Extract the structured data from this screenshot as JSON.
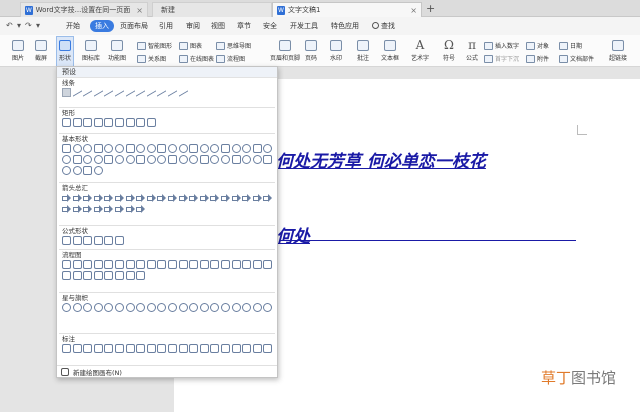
{
  "tabs": [
    {
      "label": "Word文字技...设置在同一页面",
      "active": false
    },
    {
      "label": "新建",
      "active": false
    },
    {
      "label": "文字文稿1",
      "active": true
    }
  ],
  "menu": {
    "items": [
      "开始",
      "插入",
      "页面布局",
      "引用",
      "审阅",
      "视图",
      "章节",
      "安全",
      "开发工具",
      "特色应用"
    ],
    "active": "插入",
    "search": "查找"
  },
  "ribbon": {
    "picture": "图片",
    "screenshot": "截屏",
    "shapes": "形状",
    "icon_lib": "图标库",
    "function_chart": "功能图",
    "smart_graphic": "智能图形",
    "relation_chart": "关系图",
    "chart": "图表",
    "online_chart": "在线图表",
    "mind_map": "思维导图",
    "flowchart": "流程图",
    "header_footer": "页眉和页脚",
    "page_number": "页码",
    "watermark": "水印",
    "comment": "批注",
    "textbox": "文本框",
    "art_text": "艺术字",
    "symbol": "符号",
    "formula": "公式",
    "insert_number": "插入数字",
    "object": "对象",
    "date": "日期",
    "first_letter": "首字下沉",
    "attachment": "附件",
    "doc_parts": "文档部件",
    "hyperlink": "超链接"
  },
  "document": {
    "line1": "谁何处无芳草 何必单恋一枝花",
    "line2": "谁何处"
  },
  "dropdown": {
    "header": "预设",
    "sections": [
      {
        "title": "线条",
        "count": 12
      },
      {
        "title": "矩形",
        "count": 9
      },
      {
        "title": "基本形状",
        "count": 44
      },
      {
        "title": "箭头总汇",
        "count": 28
      },
      {
        "title": "公式形状",
        "count": 6
      },
      {
        "title": "流程图",
        "count": 28
      },
      {
        "title": "星与旗帜",
        "count": 20
      },
      {
        "title": "标注",
        "count": 20
      }
    ],
    "new_canvas": "新建绘图画布(N)"
  },
  "watermark": {
    "part1": "草丁",
    "part2": "图书馆"
  }
}
